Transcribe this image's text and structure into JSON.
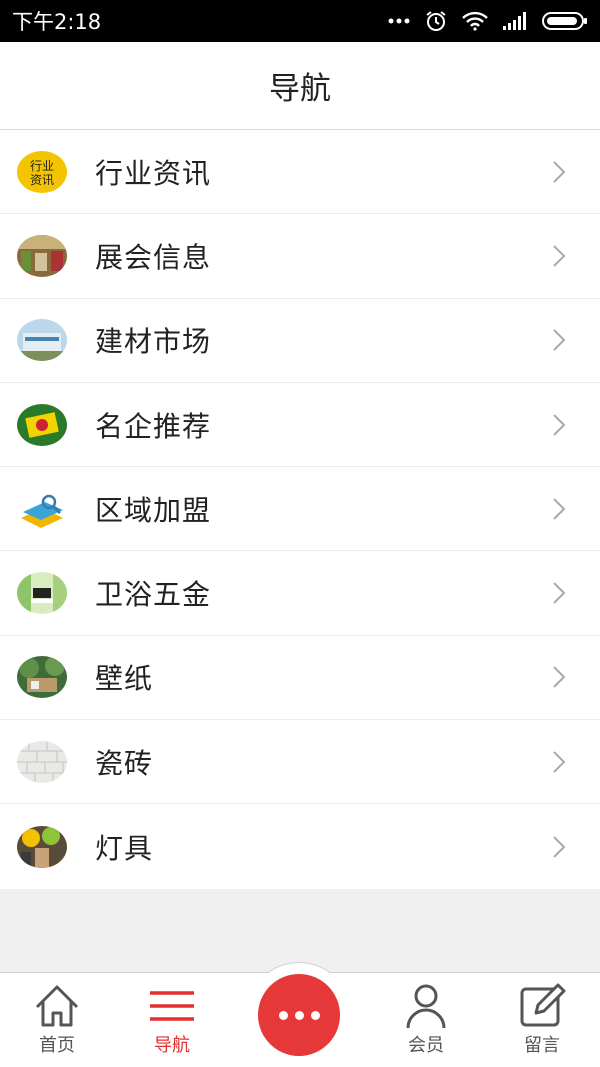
{
  "status_bar": {
    "time": "下午2:18",
    "icons": [
      "more-dots-icon",
      "alarm-icon",
      "wifi-icon",
      "signal-icon",
      "battery-icon"
    ]
  },
  "header": {
    "title": "导航"
  },
  "nav_items": [
    {
      "label": "行业资讯",
      "thumb_text": [
        "行业",
        "资讯"
      ],
      "icon": "industry-news-thumbnail"
    },
    {
      "label": "展会信息",
      "icon": "exhibition-thumbnail"
    },
    {
      "label": "建材市场",
      "icon": "building-materials-market-thumbnail"
    },
    {
      "label": "名企推荐",
      "icon": "famous-enterprise-thumbnail"
    },
    {
      "label": "区域加盟",
      "icon": "regional-franchise-thumbnail"
    },
    {
      "label": "卫浴五金",
      "icon": "bathroom-hardware-thumbnail"
    },
    {
      "label": "壁纸",
      "icon": "wallpaper-thumbnail"
    },
    {
      "label": "瓷砖",
      "icon": "tile-thumbnail"
    },
    {
      "label": "灯具",
      "icon": "lamp-thumbnail"
    }
  ],
  "tabbar": {
    "tabs": [
      {
        "label": "首页",
        "icon": "home-icon",
        "active": false
      },
      {
        "label": "导航",
        "icon": "menu-icon",
        "active": true
      },
      {
        "label": "会员",
        "icon": "user-icon",
        "active": false
      },
      {
        "label": "留言",
        "icon": "edit-message-icon",
        "active": false
      }
    ],
    "center_button_icon": "more-icon"
  },
  "colors": {
    "accent": "#e63838",
    "active_text": "#e42f2f",
    "header_bg": "#ffffff",
    "status_bg": "#000000"
  }
}
